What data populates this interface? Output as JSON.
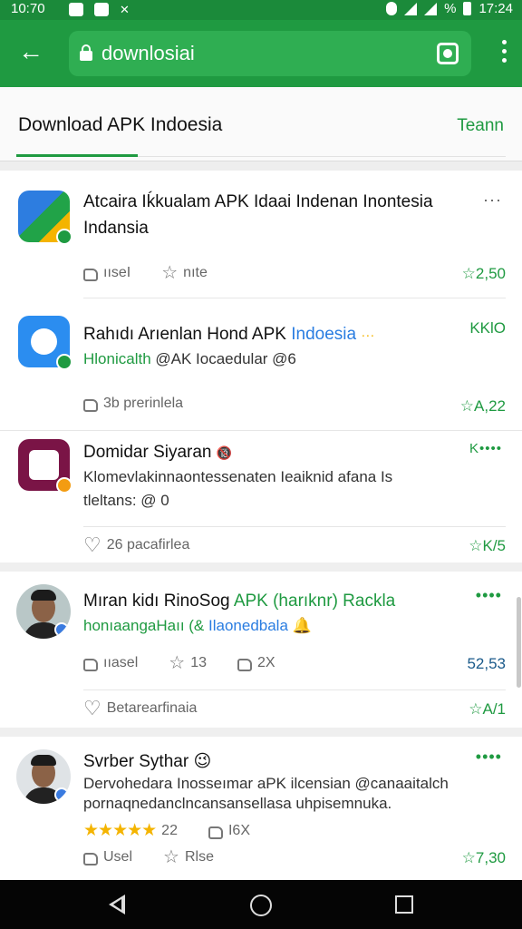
{
  "status_bar": {
    "time_left": "10:70",
    "signal_text": "%",
    "time_right": "17:24"
  },
  "browser": {
    "url": "downlosiai"
  },
  "header": {
    "title": "Download APK Indoesia",
    "action": "Teann"
  },
  "items": [
    {
      "title": "Atcaira Iḱkualam APK Idaai Indenan Inontesia",
      "title_suffix": "···",
      "title_line2": "Indansia",
      "like_label": "ııseI",
      "star_label": "nıte",
      "rating": "☆2,50"
    },
    {
      "title": "Rahıdı Arıenlan Hond APK",
      "title_blue": "Indoesia",
      "title_suffix": "···",
      "right_badge": "KKlO",
      "subtitle_green": "Hlonicalth",
      "subtitle_rest": "@AK Iocaedular @6",
      "like_label": "3b prerinlela",
      "rating": "☆A,22"
    },
    {
      "title": "Domidar Siyaran",
      "title_emoji": "🔞",
      "more": "K••••",
      "subtitle": "Klomevlakinnaontessenaten Ieaiknid afana Is",
      "subtitle_line2": "tleltans: @ 0",
      "heart_label": "26 pacafirlea",
      "rating": "☆K/5"
    },
    {
      "title": "Mıran kidı RinoSog",
      "title_green": "APK (harıknr) Rackla",
      "more": "••••",
      "subtitle_green": "honıaangaHaıı (&",
      "subtitle_blue": "Ilaonedbala",
      "subtitle_emoji": "🔔",
      "like_label": "ııasel",
      "star_label": "13",
      "thumb2_label": "2X",
      "value": "52,53",
      "heart_label": "Betarearfinaia",
      "rating": "☆A/1"
    },
    {
      "title": "Svrber Sythar",
      "title_emoji": "😉",
      "more": "••••",
      "subtitle": "Dervohedara Inosseımar aPK ilcensian @canaaitalch",
      "subtitle_line2": "pornaqnedanclncansansellasa uhpisemnuka.",
      "stars": "★★★★★",
      "stars_label": "22",
      "thumb_label": "I6X",
      "like_label": "Usel",
      "star_label": "Rlse",
      "rating": "☆7,30"
    }
  ],
  "colors": {
    "brand_green": "#1f9a41",
    "link_blue": "#2a7de1",
    "star_gold": "#f4b400"
  }
}
